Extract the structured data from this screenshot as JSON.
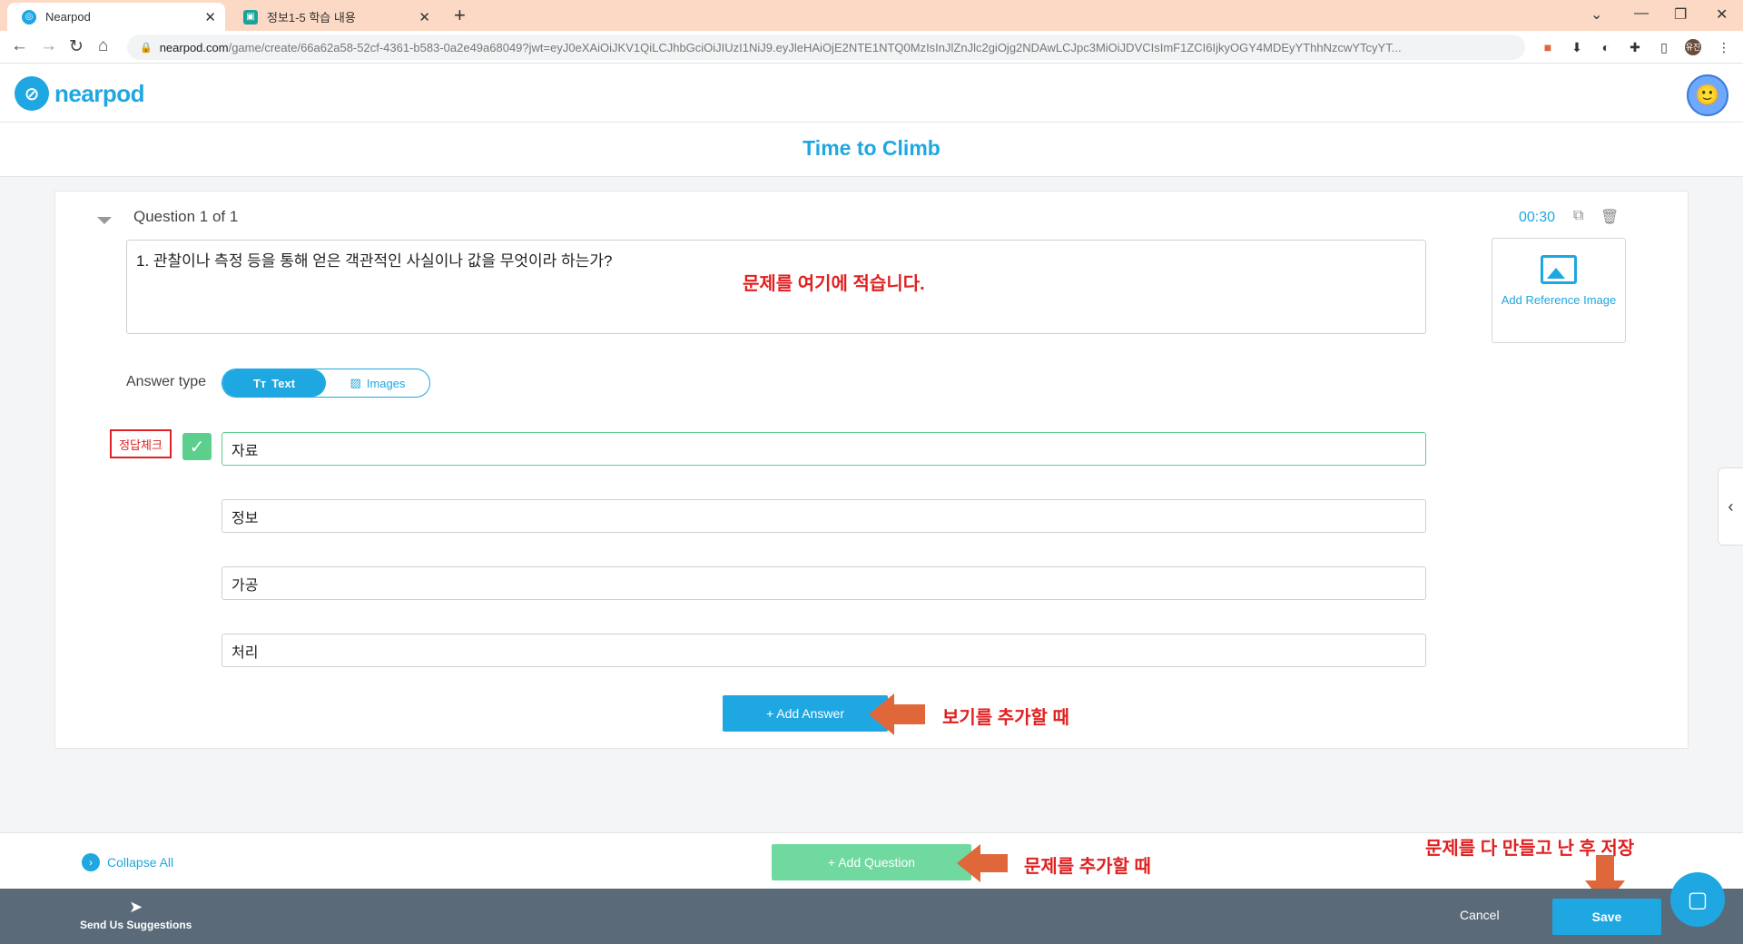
{
  "browser": {
    "tabs": [
      {
        "title": "Nearpod",
        "active": true
      },
      {
        "title": "정보1-5 학습 내용",
        "active": false
      }
    ],
    "url_host": "nearpod.com",
    "url_path": "/game/create/66a62a58-52cf-4361-b583-0a2e49a68049?jwt=eyJ0eXAiOiJKV1QiLCJhbGciOiJIUzI1NiJ9.eyJleHAiOjE2NTE1NTQ0MzIsInJlZnJlc2giOjg2NDAwLCJpc3MiOiJDVCIsImF1ZCI6IjkyOGY4MDEyYThhNzcwYTcyYT..."
  },
  "app": {
    "logo_text": "nearpod",
    "activity_title": "Time to Climb"
  },
  "question": {
    "header": "Question 1 of 1",
    "timer": "00:30",
    "text": "1. 관찰이나 측정 등을 통해 얻은 객관적인 사실이나 값을 무엇이라 하는가?",
    "ref_image_label": "Add Reference Image",
    "answer_type_label": "Answer type",
    "answer_type_options": [
      "Text",
      "Images"
    ],
    "answers": [
      "자료",
      "정보",
      "가공",
      "처리"
    ],
    "add_answer_label": "+ Add Answer"
  },
  "annotations": {
    "question_hint": "문제를 여기에 적습니다.",
    "correct_check": "정답체크",
    "add_answer_hint": "보기를 추가할 때",
    "add_question_hint": "문제를 추가할 때",
    "save_hint": "문제를 다 만들고 난 후 저장"
  },
  "actions": {
    "collapse_all": "Collapse All",
    "add_question": "+ Add Question",
    "send_suggestions": "Send Us Suggestions",
    "cancel": "Cancel",
    "save": "Save"
  },
  "colors": {
    "accent": "#1ea7e1",
    "correct_green": "#5ccf8c",
    "annotation_red": "#e02020",
    "arrow_orange": "#e0673a",
    "footer": "#5a6a78"
  }
}
